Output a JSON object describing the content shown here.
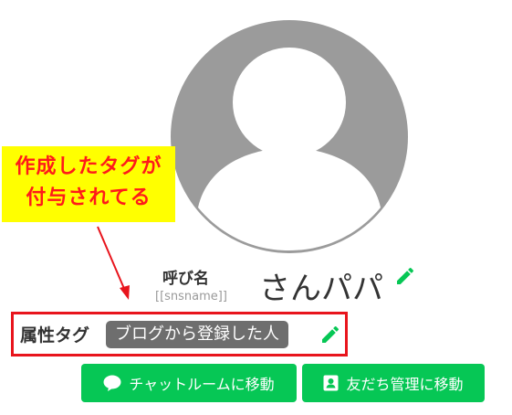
{
  "annotation": {
    "line1": "作成したタグが",
    "line2": "付与されてる"
  },
  "profile": {
    "name_label": "呼び名",
    "name_variable": "[[snsname]]",
    "name_value": "さんパパ",
    "avatar_icon": "user-avatar-icon"
  },
  "attribute": {
    "label": "属性タグ",
    "tag": "ブログから登録した人"
  },
  "buttons": {
    "chat": "チャットルームに移動",
    "friends": "友だち管理に移動"
  },
  "colors": {
    "line_green": "#06c755",
    "highlight_red": "#e8141c",
    "callout_yellow": "#ffff00",
    "tag_gray": "#6e6e6e"
  }
}
